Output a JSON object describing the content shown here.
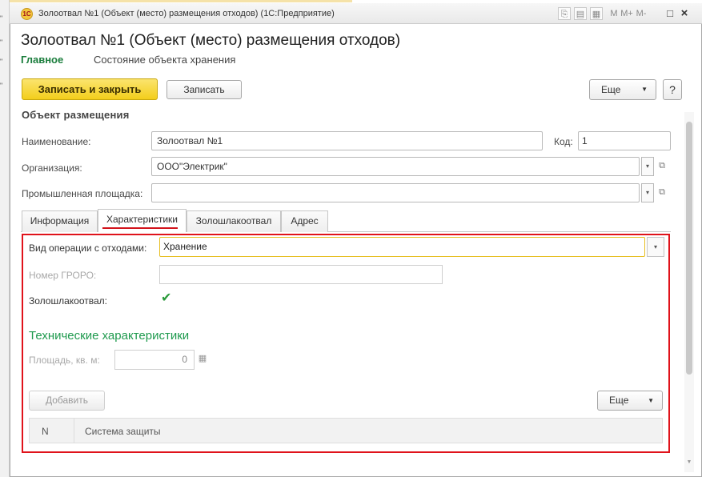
{
  "background_window": {
    "ticks": [
      "\"",
      "\"",
      "\"",
      "\""
    ]
  },
  "window": {
    "logo_text": "1С",
    "title": "Золоотвал №1 (Объект (место) размещения отходов) (1С:Предприятие)",
    "title_buttons": [
      "M",
      "M+",
      "M-"
    ],
    "close_glyph": "×",
    "restore_glyph": "□"
  },
  "form": {
    "title": "Золоотвал №1 (Объект (место) размещения отходов)",
    "nav": {
      "main": "Главное",
      "state": "Состояние объекта хранения"
    }
  },
  "toolbar": {
    "save_close": "Записать и закрыть",
    "save": "Записать",
    "more": "Еще",
    "help": "?"
  },
  "group": {
    "title": "Объект размещения"
  },
  "fields": {
    "name": {
      "label": "Наименование:",
      "value": "Золоотвал №1"
    },
    "code": {
      "label": "Код:",
      "value": "1"
    },
    "org": {
      "label": "Организация:",
      "value": "ООО\"Электрик\""
    },
    "site": {
      "label": "Промышленная площадка:",
      "value": ""
    }
  },
  "tabs": [
    {
      "label": "Информация",
      "active": false
    },
    {
      "label": "Характеристики",
      "active": true
    },
    {
      "label": "Золошлакоотвал",
      "active": false
    },
    {
      "label": "Адрес",
      "active": false
    }
  ],
  "characteristics": {
    "op_label": "Вид операции с отходами:",
    "op_value": "Хранение",
    "gropo_label": "Номер ГРОРО:",
    "gropo_value": "",
    "ash_label": "Золошлакоотвал:",
    "ash_checked": true,
    "tech_title": "Технические характеристики",
    "area_label": "Площадь, кв. м:",
    "area_value": "0",
    "add_button": "Добавить",
    "more_button": "Еще",
    "table_columns": [
      "N",
      "Система защиты"
    ]
  },
  "colors": {
    "accent_green": "#1a7d3c",
    "highlight_red": "#e0131b",
    "primary_button": "#f3ce1b"
  }
}
